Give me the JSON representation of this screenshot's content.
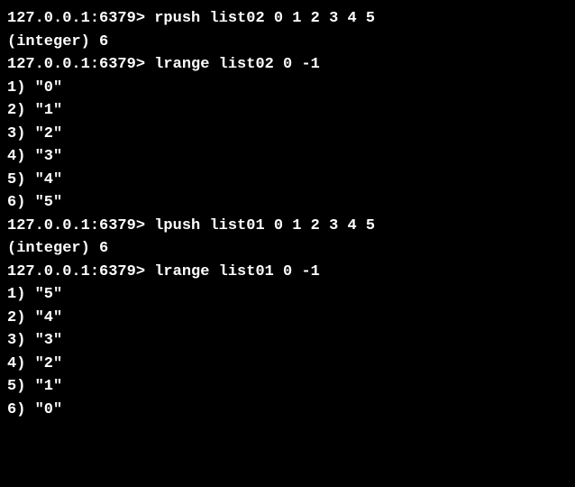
{
  "terminal": {
    "prompt": "127.0.0.1:6379>",
    "lines": [
      {
        "type": "command",
        "text": "rpush list02 0 1 2 3 4 5"
      },
      {
        "type": "output",
        "text": "(integer) 6"
      },
      {
        "type": "command",
        "text": "lrange list02 0 -1"
      },
      {
        "type": "output",
        "text": "1) \"0\""
      },
      {
        "type": "output",
        "text": "2) \"1\""
      },
      {
        "type": "output",
        "text": "3) \"2\""
      },
      {
        "type": "output",
        "text": "4) \"3\""
      },
      {
        "type": "output",
        "text": "5) \"4\""
      },
      {
        "type": "output",
        "text": "6) \"5\""
      },
      {
        "type": "command",
        "text": "lpush list01 0 1 2 3 4 5"
      },
      {
        "type": "output",
        "text": "(integer) 6"
      },
      {
        "type": "command",
        "text": "lrange list01 0 -1"
      },
      {
        "type": "output",
        "text": "1) \"5\""
      },
      {
        "type": "output",
        "text": "2) \"4\""
      },
      {
        "type": "output",
        "text": "3) \"3\""
      },
      {
        "type": "output",
        "text": "4) \"2\""
      },
      {
        "type": "output",
        "text": "5) \"1\""
      },
      {
        "type": "output",
        "text": "6) \"0\""
      }
    ]
  }
}
